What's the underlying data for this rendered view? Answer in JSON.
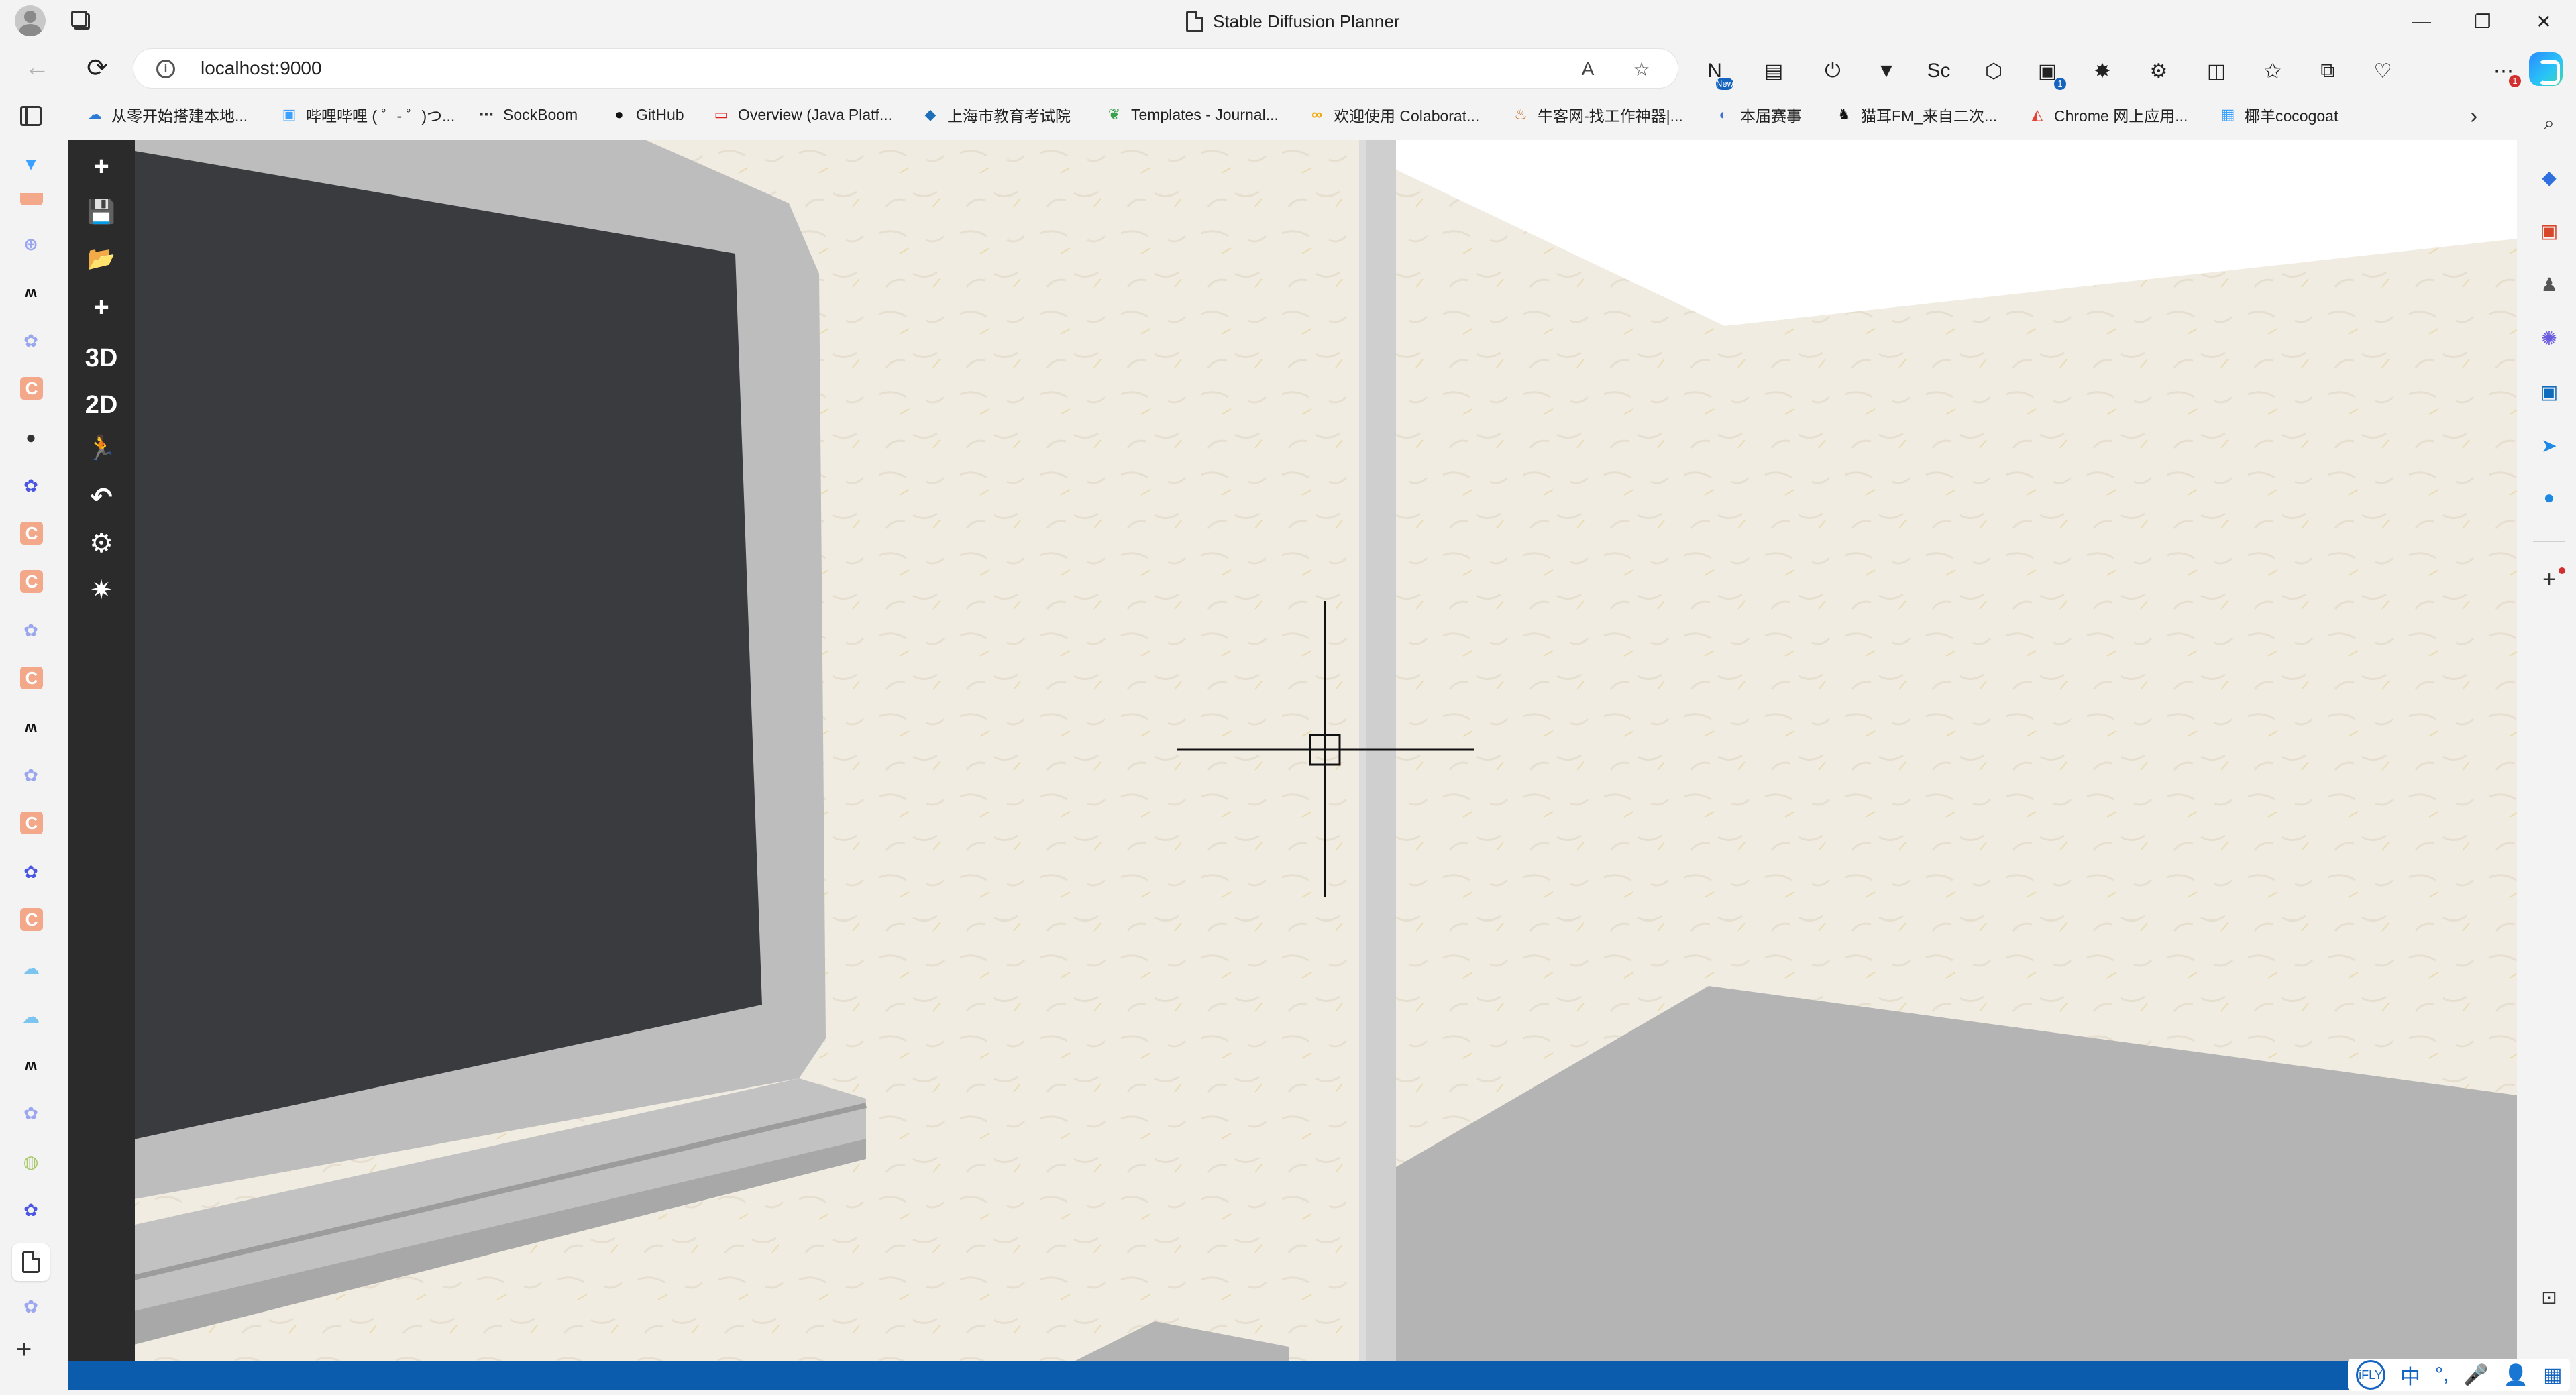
{
  "window": {
    "title": "Stable Diffusion Planner",
    "controls": {
      "minimize": "—",
      "maximize": "❐",
      "close": "✕"
    }
  },
  "nav": {
    "back": "←",
    "refresh": "⟳",
    "url": "localhost:9000",
    "read_aloud": "A",
    "favorite": "☆"
  },
  "toolbar_icons": [
    {
      "name": "new-badge-icon",
      "glyph": "N",
      "badge": "New"
    },
    {
      "name": "reading-icon",
      "glyph": "▤"
    },
    {
      "name": "power-icon",
      "glyph": "⏻"
    },
    {
      "name": "vpn-icon",
      "glyph": "▼"
    },
    {
      "name": "sc-icon",
      "glyph": "Sc"
    },
    {
      "name": "box-icon",
      "glyph": "⬡"
    },
    {
      "name": "terminal-icon",
      "glyph": "▣",
      "badge": "1"
    },
    {
      "name": "game-icon",
      "glyph": "✸"
    },
    {
      "name": "extensions-icon",
      "glyph": "⚙"
    },
    {
      "name": "split-screen-icon",
      "glyph": "◫"
    },
    {
      "name": "favorites-icon",
      "glyph": "✩"
    },
    {
      "name": "collections-icon",
      "glyph": "⧉"
    },
    {
      "name": "health-icon",
      "glyph": "♡"
    },
    {
      "name": "more-icon",
      "glyph": "⋯",
      "badge": "1"
    }
  ],
  "bookmarks": [
    {
      "label": "从零开始搭建本地...",
      "icon": "☁",
      "color": "#2b7bd6"
    },
    {
      "label": "哔哩哔哩 ( ゜- ゜)つ...",
      "icon": "▣",
      "color": "#3aa1ff"
    },
    {
      "label": "SockBoom",
      "icon": "⋯",
      "color": "#333333"
    },
    {
      "label": "GitHub",
      "icon": "●",
      "color": "#111111"
    },
    {
      "label": "Overview (Java Platf...",
      "icon": "▭",
      "color": "#e11d1d"
    },
    {
      "label": "上海市教育考试院",
      "icon": "◆",
      "color": "#1d6fb8"
    },
    {
      "label": "Templates - Journal...",
      "icon": "❦",
      "color": "#3aa14a"
    },
    {
      "label": "欢迎使用 Colaborat...",
      "icon": "∞",
      "color": "#f2a600"
    },
    {
      "label": "牛客网-找工作神器|...",
      "icon": "♨",
      "color": "#c8702a"
    },
    {
      "label": "本届赛事",
      "icon": "◐",
      "color": "#3c6fd1"
    },
    {
      "label": "猫耳FM_来自二次...",
      "icon": "♞",
      "color": "#111111"
    },
    {
      "label": "Chrome 网上应用...",
      "icon": "◭",
      "color": "#e34133"
    },
    {
      "label": "椰羊cocogoat",
      "icon": "▦",
      "color": "#3aa1ff"
    }
  ],
  "bookmarks_more": "›",
  "app_toolbar": {
    "new": "+",
    "save": "💾",
    "open": "📂",
    "add": "+",
    "view_3d": "3D",
    "view_2d": "2D",
    "walk": "🏃",
    "undo": "↶",
    "settings": "⚙",
    "render": "✷"
  },
  "ime": {
    "logo": "iFLY",
    "lang": "中",
    "punct": "°,",
    "mic": "🎤",
    "user": "👤",
    "apps": "▦"
  },
  "colors": {
    "accent": "#2f86ff",
    "statusbar": "#0b5cad",
    "toolbar_bg": "#2b2b2b",
    "wall": "#f1ece1",
    "floor": "#b4b4b4",
    "tv_screen": "#393b3f",
    "tv_frame": "#bdbdbd"
  }
}
